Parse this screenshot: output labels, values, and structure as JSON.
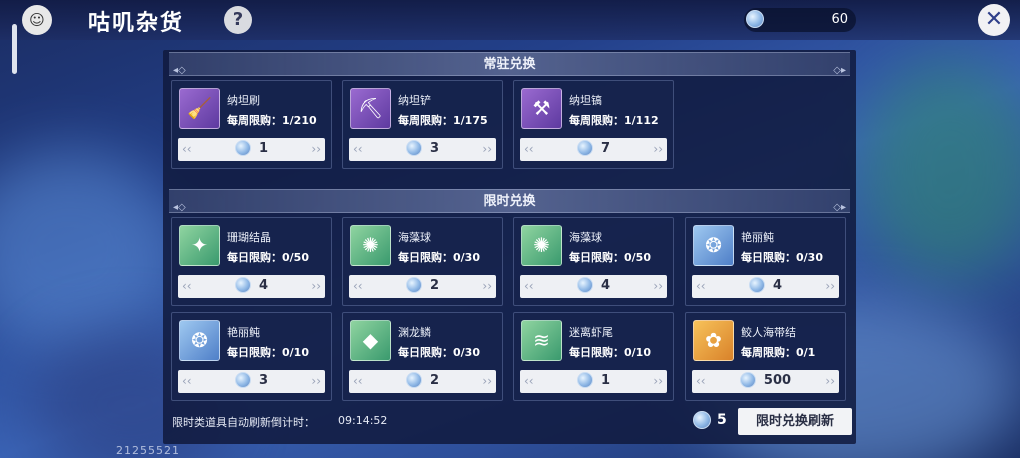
{
  "header": {
    "title": "咕叽杂货",
    "help_label": "?",
    "currency_amount": "60",
    "close_label": "✕"
  },
  "regular_section": {
    "title": "常驻兑换",
    "items": [
      {
        "name": "纳坦刷",
        "limit": "每周限购：1/210",
        "price": "1",
        "icon": "brush-icon",
        "color": "purple"
      },
      {
        "name": "纳坦铲",
        "limit": "每周限购：1/175",
        "price": "3",
        "icon": "shovel-icon",
        "color": "purple"
      },
      {
        "name": "纳坦镐",
        "limit": "每周限购：1/112",
        "price": "7",
        "icon": "pickaxe-icon",
        "color": "purple"
      }
    ]
  },
  "limited_section": {
    "title": "限时兑换",
    "items": [
      {
        "name": "珊瑚结晶",
        "limit": "每日限购：0/50",
        "price": "4",
        "icon": "coral-crystal-icon",
        "color": "green"
      },
      {
        "name": "海藻球",
        "limit": "每日限购：0/30",
        "price": "2",
        "icon": "seaweed-ball-icon",
        "color": "green"
      },
      {
        "name": "海藻球",
        "limit": "每日限购：0/50",
        "price": "4",
        "icon": "seaweed-ball-icon",
        "color": "green"
      },
      {
        "name": "艳丽鲀",
        "limit": "每日限购：0/30",
        "price": "4",
        "icon": "pufferfish-icon",
        "color": "blue"
      },
      {
        "name": "艳丽鲀",
        "limit": "每日限购：0/10",
        "price": "3",
        "icon": "pufferfish-icon",
        "color": "blue"
      },
      {
        "name": "渊龙鳞",
        "limit": "每日限购：0/30",
        "price": "2",
        "icon": "dragon-scale-icon",
        "color": "green"
      },
      {
        "name": "迷离虾尾",
        "limit": "每日限购：0/10",
        "price": "1",
        "icon": "shrimp-tail-icon",
        "color": "green"
      },
      {
        "name": "鲛人海带结",
        "limit": "每周限购：0/1",
        "price": "500",
        "icon": "kelp-knot-icon",
        "color": "orange"
      }
    ]
  },
  "footer": {
    "countdown_label": "限时类道具自动刷新倒计时：",
    "countdown_value": "09:14:52",
    "refresh_cost": "5",
    "refresh_button": "限时兑换刷新"
  },
  "uid": "21255521"
}
